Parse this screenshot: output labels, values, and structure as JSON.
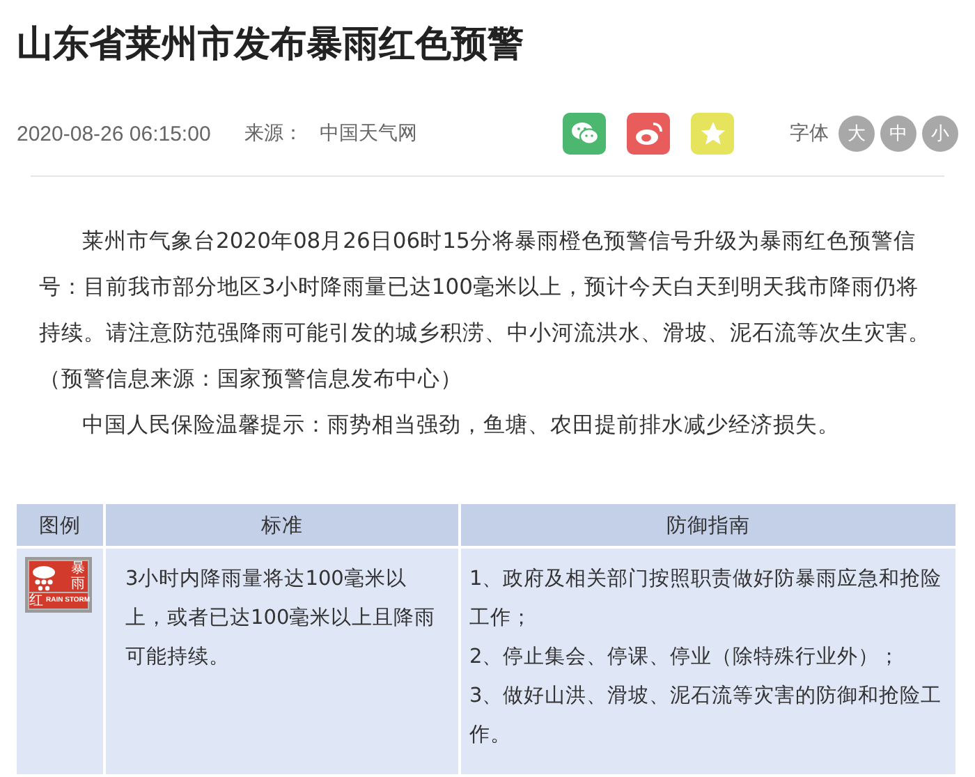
{
  "title": "山东省莱州市发布暴雨红色预警",
  "meta": {
    "datetime": "2020-08-26 06:15:00",
    "source_label": "来源：",
    "source": "中国天气网",
    "font_label": "字体",
    "share": [
      {
        "kind": "wechat",
        "color": "#4cb86f"
      },
      {
        "kind": "weibo",
        "color": "#e85c5c"
      },
      {
        "kind": "favorite",
        "color": "#e6e35c"
      }
    ],
    "font_sizes": [
      "大",
      "中",
      "小"
    ]
  },
  "paragraphs": [
    {
      "text": "莱州市气象台2020年08月26日06时15分将暴雨橙色预警信号升级为暴雨红色预警信号：目前我市部分地区3小时降雨量已达100毫米以上，预计今天白天到明天我市降雨仍将持续。请注意防范强降雨可能引发的城乡积涝、中小河流洪水、滑坡、泥石流等次生灾害。",
      "indent": true
    },
    {
      "text": "（预警信息来源：国家预警信息发布中心）",
      "indent": false
    },
    {
      "text": "中国人民保险温馨提示：雨势相当强劲，鱼塘、农田提前排水减少经济损失。",
      "indent": true
    }
  ],
  "table": {
    "columns": [
      "图例",
      "标准",
      "防御指南"
    ],
    "rows": [
      {
        "icon": {
          "title": "暴雨",
          "level": "红",
          "english": "RAIN STORM"
        },
        "standard": "3小时内降雨量将达100毫米以上，或者已达100毫米以上且降雨可能持续。",
        "guide": [
          "1、政府及相关部门按照职责做好防暴雨应急和抢险工作；",
          "2、停止集会、停课、停业（除特殊行业外）；",
          "3、做好山洪、滑坡、泥石流等灾害的防御和抢险工作。"
        ]
      }
    ]
  }
}
